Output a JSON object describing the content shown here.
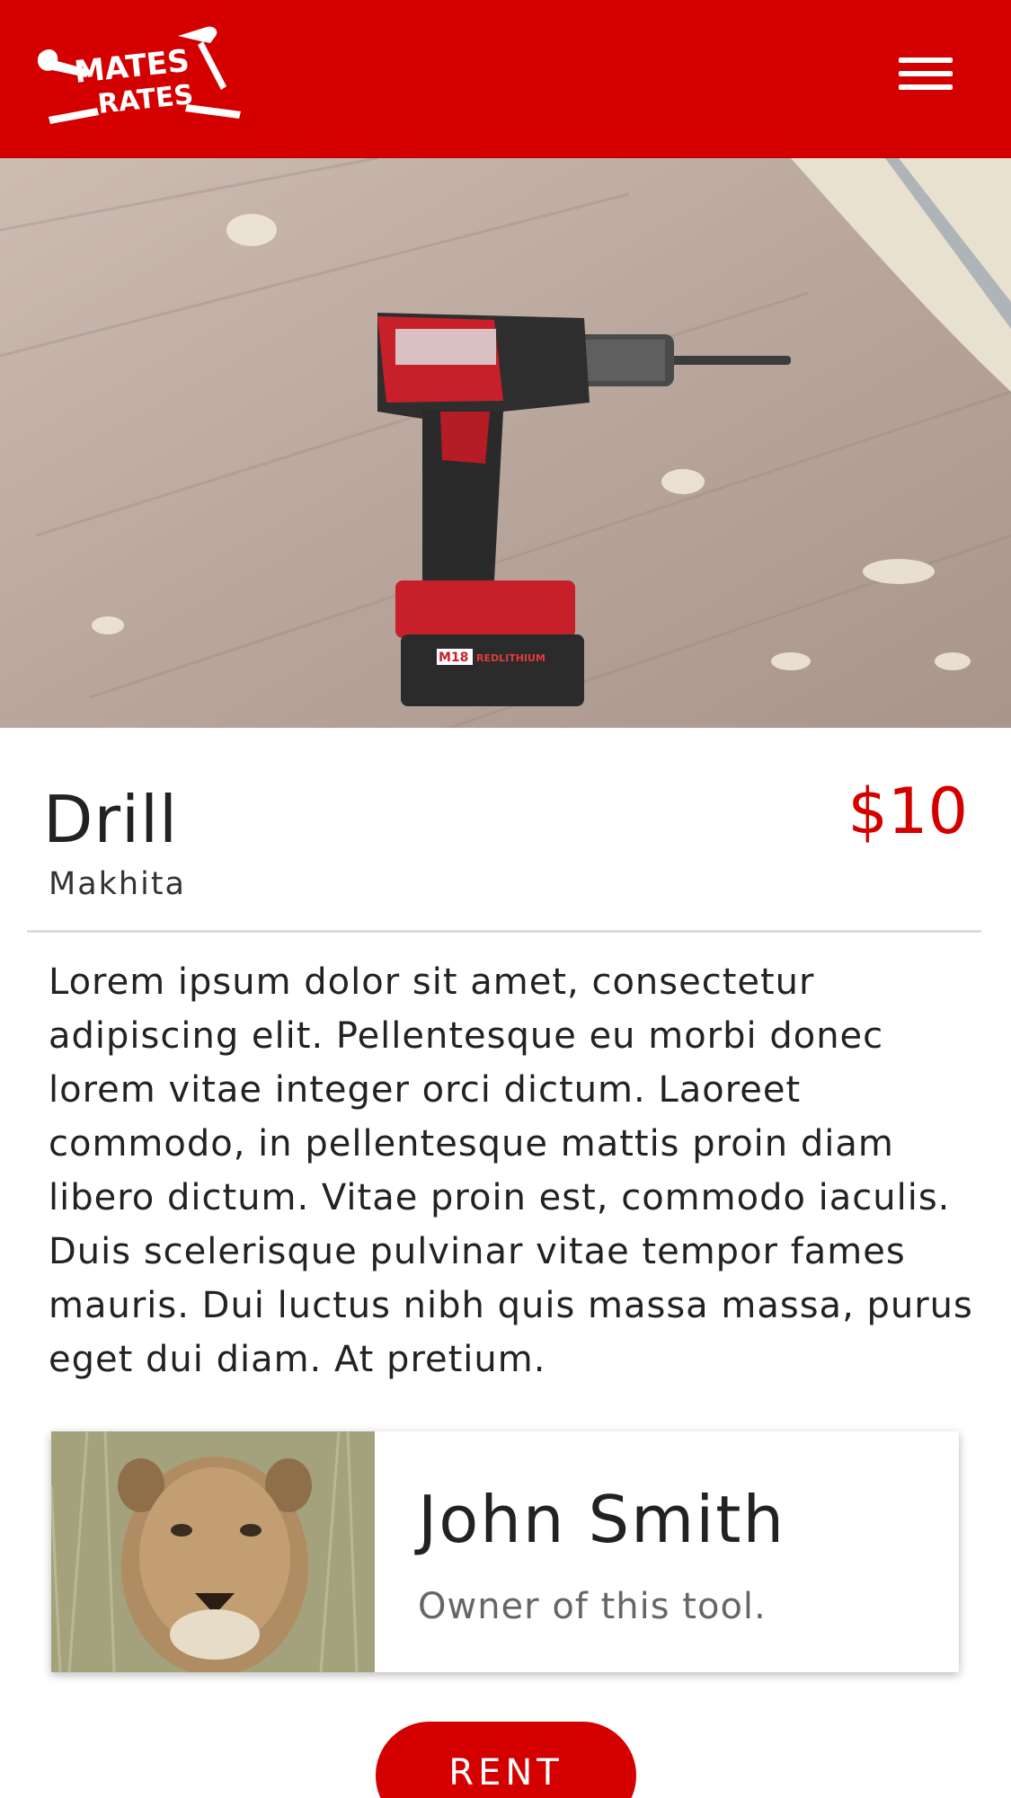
{
  "brand": {
    "logo_line1": "MATES",
    "logo_line2": "RATES",
    "header_color": "#d40000"
  },
  "header": {
    "menu_icon": "hamburger-menu-icon"
  },
  "hero": {
    "image": "cordless-drill-on-sawdust-floor",
    "battery_brand": "M18",
    "battery_text": "REDLITHIUM"
  },
  "tool": {
    "name": "Drill",
    "brand": "Makhita",
    "price": "$10",
    "description": "Lorem ipsum dolor sit amet, consectetur adipiscing elit. Pellentesque eu morbi donec lorem vitae integer orci dictum. Laoreet commodo, in pellentesque mattis proin diam libero dictum. Vitae proin est, commodo iaculis. Duis scelerisque pulvinar vitae tempor fames mauris. Dui luctus nibh quis massa massa, purus eget dui diam. At pretium."
  },
  "owner": {
    "name": "John Smith",
    "role": "Owner of this tool.",
    "avatar": "lion-avatar"
  },
  "actions": {
    "rent_label": "RENT"
  },
  "colors": {
    "accent": "#d40000",
    "text": "#222222",
    "muted": "#666666"
  }
}
